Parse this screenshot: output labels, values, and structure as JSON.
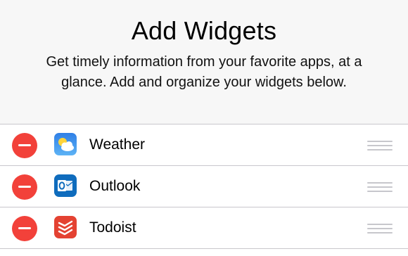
{
  "header": {
    "title": "Add Widgets",
    "subtitle": "Get timely information from your favorite apps, at a glance. Add and organize your widgets below."
  },
  "widgets": [
    {
      "name": "Weather",
      "icon": "weather-app-icon",
      "icon_color": "#3a8ff0"
    },
    {
      "name": "Outlook",
      "icon": "outlook-app-icon",
      "icon_color": "#0f6cbd"
    },
    {
      "name": "Todoist",
      "icon": "todoist-app-icon",
      "icon_color": "#e44232"
    }
  ],
  "colors": {
    "remove": "#f2413a",
    "separator": "#c8c7cc",
    "grabber": "#c7c7cc",
    "header_bg": "#f7f7f7"
  }
}
